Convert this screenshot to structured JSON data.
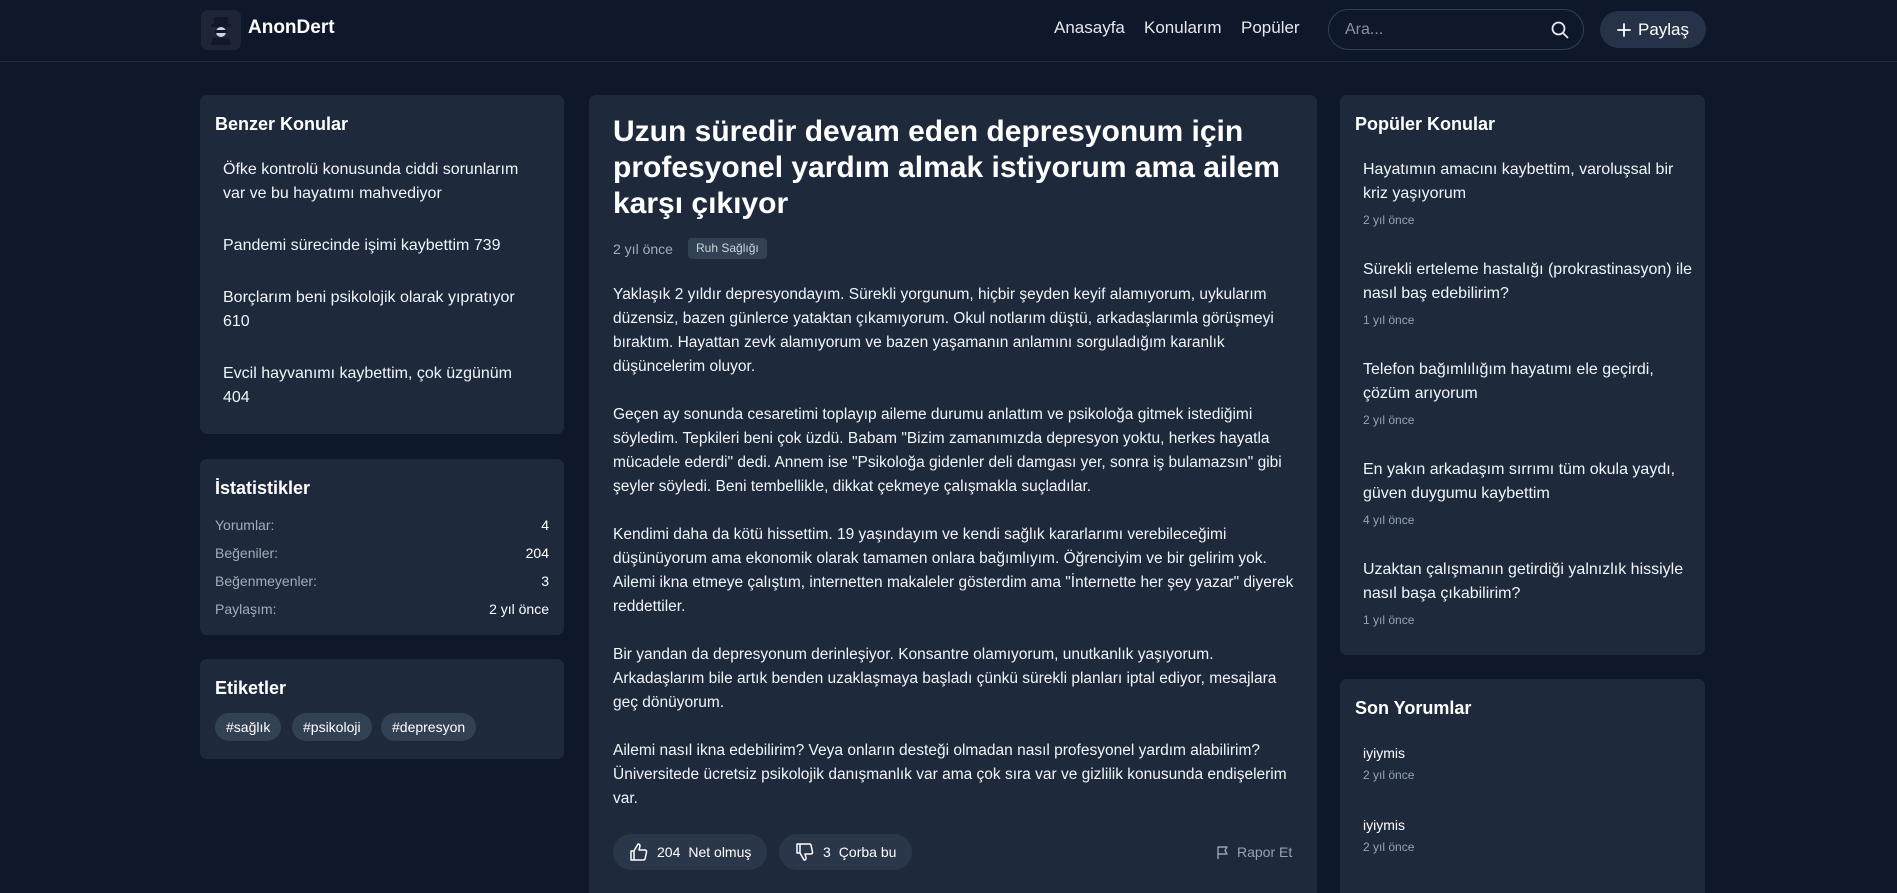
{
  "header": {
    "brand": "AnonDert",
    "nav": [
      "Anasayfa",
      "Konularım",
      "Popüler"
    ],
    "search_placeholder": "Ara...",
    "share_label": "Paylaş"
  },
  "similar": {
    "title": "Benzer Konular",
    "items": [
      "Öfke kontrolü konusunda ciddi sorunlarım var ve bu hayatımı mahvediyor",
      "Pandemi sürecinde işimi kaybettim 739",
      "Borçlarım beni psikolojik olarak yıpratıyor 610",
      "Evcil hayvanımı kaybettim, çok üzgünüm 404"
    ]
  },
  "stats": {
    "title": "İstatistikler",
    "rows": [
      {
        "label": "Yorumlar:",
        "value": "4"
      },
      {
        "label": "Beğeniler:",
        "value": "204"
      },
      {
        "label": "Beğenmeyenler:",
        "value": "3"
      },
      {
        "label": "Paylaşım:",
        "value": "2 yıl önce"
      }
    ]
  },
  "tags": {
    "title": "Etiketler",
    "items": [
      "#sağlık",
      "#psikoloji",
      "#depresyon"
    ]
  },
  "post": {
    "title": "Uzun süredir devam eden depresyonum için profesyonel yardım almak istiyorum ama ailem karşı çıkıyor",
    "time": "2 yıl önce",
    "category": "Ruh Sağlığı",
    "paragraphs": [
      "Yaklaşık 2 yıldır depresyondayım. Sürekli yorgunum, hiçbir şeyden keyif alamıyorum, uykularım düzensiz, bazen günlerce yataktan çıkamıyorum. Okul notlarım düştü, arkadaşlarımla görüşmeyi bıraktım. Hayattan zevk alamıyorum ve bazen yaşamanın anlamını sorguladığım karanlık düşüncelerim oluyor.",
      "Geçen ay sonunda cesaretimi toplayıp aileme durumu anlattım ve psikoloğa gitmek istediğimi söyledim. Tepkileri beni çok üzdü. Babam \"Bizim zamanımızda depresyon yoktu, herkes hayatla mücadele ederdi\" dedi. Annem ise \"Psikoloğa gidenler deli damgası yer, sonra iş bulamazsın\" gibi şeyler söyledi. Beni tembellikle, dikkat çekmeye çalışmakla suçladılar.",
      "Kendimi daha da kötü hissettim. 19 yaşındayım ve kendi sağlık kararlarımı verebileceğimi düşünüyorum ama ekonomik olarak tamamen onlara bağımlıyım. Öğrenciyim ve bir gelirim yok. Ailemi ikna etmeye çalıştım, internetten makaleler gösterdim ama \"İnternette her şey yazar\" diyerek reddettiler.",
      "Bir yandan da depresyonum derinleşiyor. Konsantre olamıyorum, unutkanlık yaşıyorum. Arkadaşlarım bile artık benden uzaklaşmaya başladı çünkü sürekli planları iptal ediyor, mesajlara geç dönüyorum.",
      "Ailemi nasıl ikna edebilirim? Veya onların desteği olmadan nasıl profesyonel yardım alabilirim? Üniversitede ücretsiz psikolojik danışmanlık var ama çok sıra var ve gizlilik konusunda endişelerim var."
    ],
    "like_count": "204",
    "like_label": "Net olmuş",
    "dislike_count": "3",
    "dislike_label": "Çorba bu",
    "report_label": "Rapor Et"
  },
  "popular": {
    "title": "Popüler Konular",
    "items": [
      {
        "title": "Hayatımın amacını kaybettim, varoluşsal bir kriz yaşıyorum",
        "time": "2 yıl önce"
      },
      {
        "title": "Sürekli erteleme hastalığı (prokrastinasyon) ile nasıl baş edebilirim?",
        "time": "1 yıl önce"
      },
      {
        "title": "Telefon bağımlılığım hayatımı ele geçirdi, çözüm arıyorum",
        "time": "2 yıl önce"
      },
      {
        "title": "En yakın arkadaşım sırrımı tüm okula yaydı, güven duygumu kaybettim",
        "time": "4 yıl önce"
      },
      {
        "title": "Uzaktan çalışmanın getirdiği yalnızlık hissiyle nasıl başa çıkabilirim?",
        "time": "1 yıl önce"
      }
    ]
  },
  "comments": {
    "title": "Son Yorumlar",
    "items": [
      {
        "name": "iyiymis",
        "time": "2 yıl önce"
      },
      {
        "name": "iyiymis",
        "time": "2 yıl önce"
      }
    ]
  }
}
